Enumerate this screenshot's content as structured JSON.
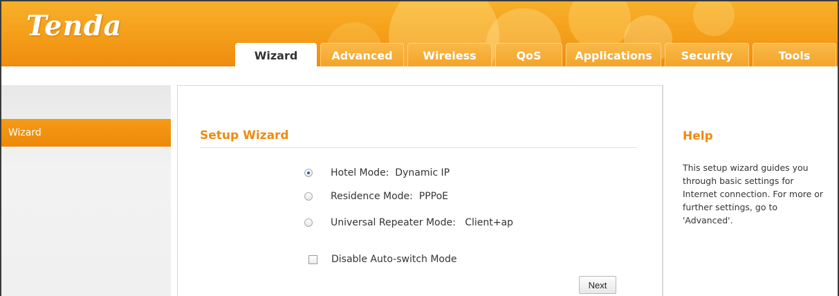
{
  "brand": {
    "logo_text": "Tenda"
  },
  "nav": {
    "tabs": [
      {
        "label": "Wizard",
        "active": true
      },
      {
        "label": "Advanced",
        "active": false
      },
      {
        "label": "Wireless",
        "active": false
      },
      {
        "label": "QoS",
        "active": false
      },
      {
        "label": "Applications",
        "active": false
      },
      {
        "label": "Security",
        "active": false
      },
      {
        "label": "Tools",
        "active": false
      }
    ]
  },
  "sidebar": {
    "items": [
      {
        "label": "Wizard",
        "active": true
      }
    ]
  },
  "main": {
    "title": "Setup Wizard",
    "options": [
      {
        "label": "Hotel Mode:  Dynamic IP",
        "checked": true
      },
      {
        "label": "Residence Mode:  PPPoE",
        "checked": false
      },
      {
        "label": "Universal Repeater Mode:   Client+ap",
        "checked": false
      }
    ],
    "disable_auto_switch": {
      "label": "Disable Auto-switch Mode",
      "checked": false
    },
    "next_label": "Next"
  },
  "help": {
    "title": "Help",
    "text": "This setup wizard guides you through basic settings for Internet connection. For more or further settings, go to 'Advanced'."
  },
  "colors": {
    "accent": "#f08a0b",
    "header": "#f5a11c",
    "sidebar_active": "#f59a18"
  }
}
